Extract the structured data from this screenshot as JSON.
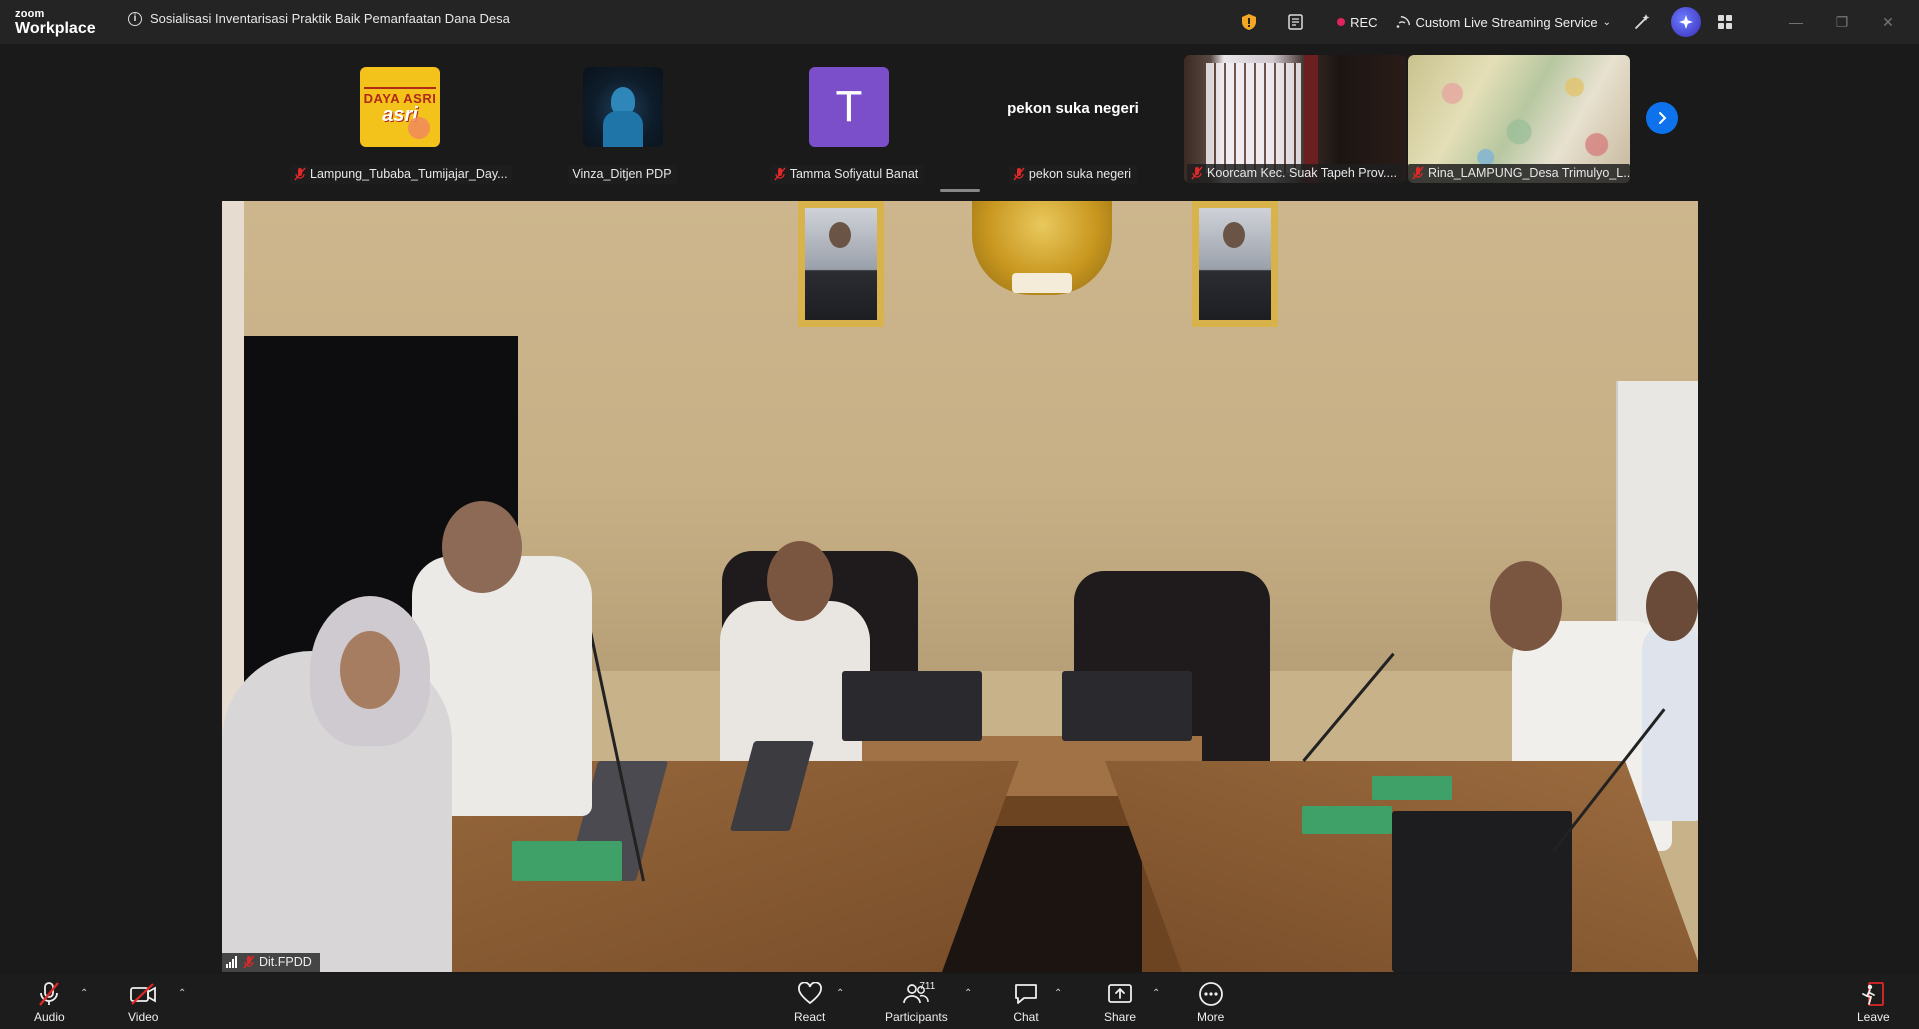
{
  "app": {
    "logo_line1": "zoom",
    "logo_line2": "Workplace",
    "meeting_title": "Sosialisasi Inventarisasi Praktik Baik Pemanfaatan Dana Desa"
  },
  "titlebar": {
    "rec_label": "REC",
    "streaming_label": "Custom Live Streaming Service",
    "icons": [
      "shield-icon",
      "notes-icon",
      "record-dot-icon",
      "streaming-icon",
      "chevron-down-icon",
      "magic-wand-icon",
      "ai-companion-icon",
      "apps-icon",
      "minimize-icon",
      "restore-icon",
      "close-icon"
    ]
  },
  "participants": [
    {
      "name": "Lampung_Tubaba_Tumijajar_Day...",
      "muted": true,
      "type": "image-avatar",
      "avatar_text_1": "DAYA ASRI",
      "avatar_text_2": "asri"
    },
    {
      "name": "Vinza_Ditjen PDP",
      "muted": false,
      "type": "image-avatar"
    },
    {
      "name": "Tamma Sofiyatul Banat",
      "muted": true,
      "type": "letter-avatar",
      "letter": "T",
      "color": "#7b4fc9"
    },
    {
      "name": "pekon suka negeri",
      "muted": true,
      "type": "name-only",
      "display": "pekon suka negeri"
    },
    {
      "name": "Koorcam Kec. Suak Tapeh Prov....",
      "muted": true,
      "type": "video"
    },
    {
      "name": "Rina_LAMPUNG_Desa Trimulyo_L...",
      "muted": true,
      "type": "video"
    }
  ],
  "main_video": {
    "speaker_label": "Dit.FPDD",
    "muted": true
  },
  "toolbar": {
    "audio": "Audio",
    "video": "Video",
    "react": "React",
    "participants": "Participants",
    "participants_count": "711",
    "chat": "Chat",
    "share": "Share",
    "more": "More",
    "leave": "Leave"
  },
  "colors": {
    "accent_blue": "#0e72ed",
    "rec_red": "#e0245e",
    "muted_red": "#e02828",
    "background": "#1a1a1a"
  }
}
